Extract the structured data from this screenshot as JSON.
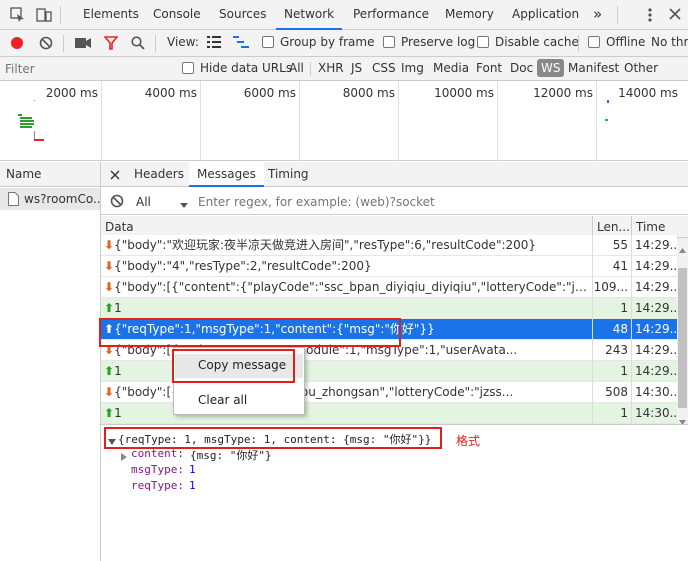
{
  "devtools_tabs": [
    "Elements",
    "Console",
    "Sources",
    "Network",
    "Performance",
    "Memory",
    "Application"
  ],
  "more_tabs": "»",
  "toolbar": {
    "view_label": "View:",
    "group_by_frame": "Group by frame",
    "preserve_log": "Preserve log",
    "disable_cache": "Disable cache",
    "offline": "Offline",
    "throttle": "No thro"
  },
  "filter": {
    "placeholder": "Filter",
    "hide_data_urls": "Hide data URLs",
    "types": [
      "All",
      "XHR",
      "JS",
      "CSS",
      "Img",
      "Media",
      "Font",
      "Doc",
      "WS",
      "Manifest",
      "Other"
    ]
  },
  "timeline": {
    "ticks": [
      "2000 ms",
      "4000 ms",
      "6000 ms",
      "8000 ms",
      "10000 ms",
      "12000 ms",
      "14000 ms"
    ]
  },
  "name_column": {
    "header": "Name",
    "item": "ws?roomCo..."
  },
  "detail_tabs": [
    "Headers",
    "Messages",
    "Timing"
  ],
  "message_filter": {
    "select": "All",
    "placeholder": "Enter regex, for example: (web)?socket"
  },
  "table_headers": {
    "data": "Data",
    "length": "Len...",
    "time": "Time"
  },
  "messages": [
    {
      "dir": "down",
      "data": "{\"body\":\"欢迎玩家:夜半凉天做竞进入房间\",\"resType\":6,\"resultCode\":200}",
      "len": "55",
      "time": "14:29..."
    },
    {
      "dir": "down",
      "data": "{\"body\":\"4\",\"resType\":2,\"resultCode\":200}",
      "len": "41",
      "time": "14:29..."
    },
    {
      "dir": "down",
      "data": "{\"body\":[{\"content\":{\"playCode\":\"ssc_bpan_diyiqiu_diyiqiu\",\"lotteryCode\":\"jzssc\",\"handica...",
      "len": "109...",
      "time": "14:29..."
    },
    {
      "dir": "up",
      "data": "1",
      "len": "1",
      "time": "14:29..."
    },
    {
      "dir": "up",
      "data": "{\"reqType\":1,\"msgType\":1,\"content\":{\"msg\":\"你好\"}}",
      "len": "48",
      "time": "14:29...",
      "selected": true
    },
    {
      "dir": "down",
      "data": "{\"body\":[{\"c                 dex\":3842638\",\"module\":1,\"msgType\":1,\"userAvata...",
      "len": "243",
      "time": "14:29..."
    },
    {
      "dir": "up",
      "data": "1",
      "len": "1",
      "time": "14:29..."
    },
    {
      "dir": "down",
      "data": "{\"body\":[{\"c                 bpan_qianzhonghou_zhongsan\",\"lotteryCode\":\"jzss...",
      "len": "508",
      "time": "14:30..."
    },
    {
      "dir": "up",
      "data": "1",
      "len": "1",
      "time": "14:30..."
    }
  ],
  "context_menu": {
    "copy": "Copy message",
    "clear": "Clear all"
  },
  "detail": {
    "summary": "{reqType: 1, msgType: 1, content: {msg: \"你好\"}}",
    "content_key": "content:",
    "content_val": "{msg: \"你好\"}",
    "msgtype_key": "msgType:",
    "msgtype_val": "1",
    "reqtype_key": "reqType:",
    "reqtype_val": "1",
    "annotation": "格式"
  },
  "colors": {
    "accent": "#1a73e8",
    "annotation_red": "#e0201a",
    "sent_bg": "#e3f5e1"
  }
}
